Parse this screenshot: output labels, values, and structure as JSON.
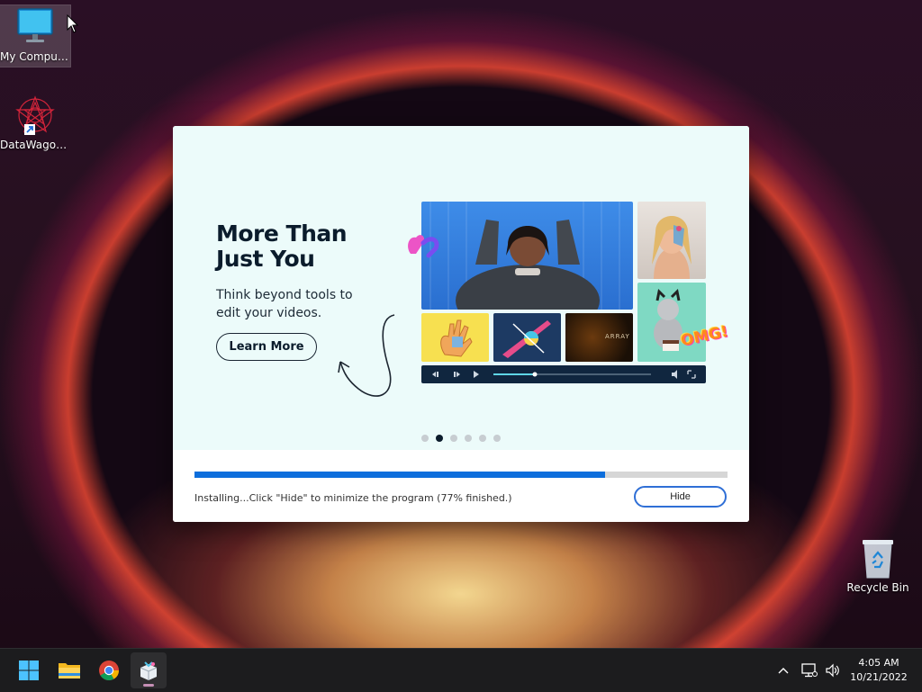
{
  "desktop": {
    "icons": [
      {
        "label": "My Computer"
      },
      {
        "label": "DataWagon..."
      },
      {
        "label": "Recycle Bin"
      }
    ]
  },
  "installer": {
    "headline_line1": "More Than",
    "headline_line2": "Just You",
    "subtext": "Think beyond tools to edit your videos.",
    "learn_more_label": "Learn More",
    "carousel_total": 6,
    "carousel_active_index": 1,
    "progress_fraction": 0.77,
    "status_text": "Installing...Click \"Hide\" to minimize the program (77% finished.)",
    "hide_label": "Hide",
    "collage_text": {
      "array_label": "ARRAY",
      "omg_sticker": "OMG!"
    }
  },
  "taskbar": {
    "clock_time": "4:05 AM",
    "clock_date": "10/21/2022",
    "pinned": [
      "start-icon",
      "file-explorer-icon",
      "chrome-icon",
      "installer-app-icon"
    ]
  },
  "colors": {
    "accent_blue": "#0d6edc",
    "banner_bg": "#ecfbfa",
    "headline": "#0b1c2c"
  }
}
